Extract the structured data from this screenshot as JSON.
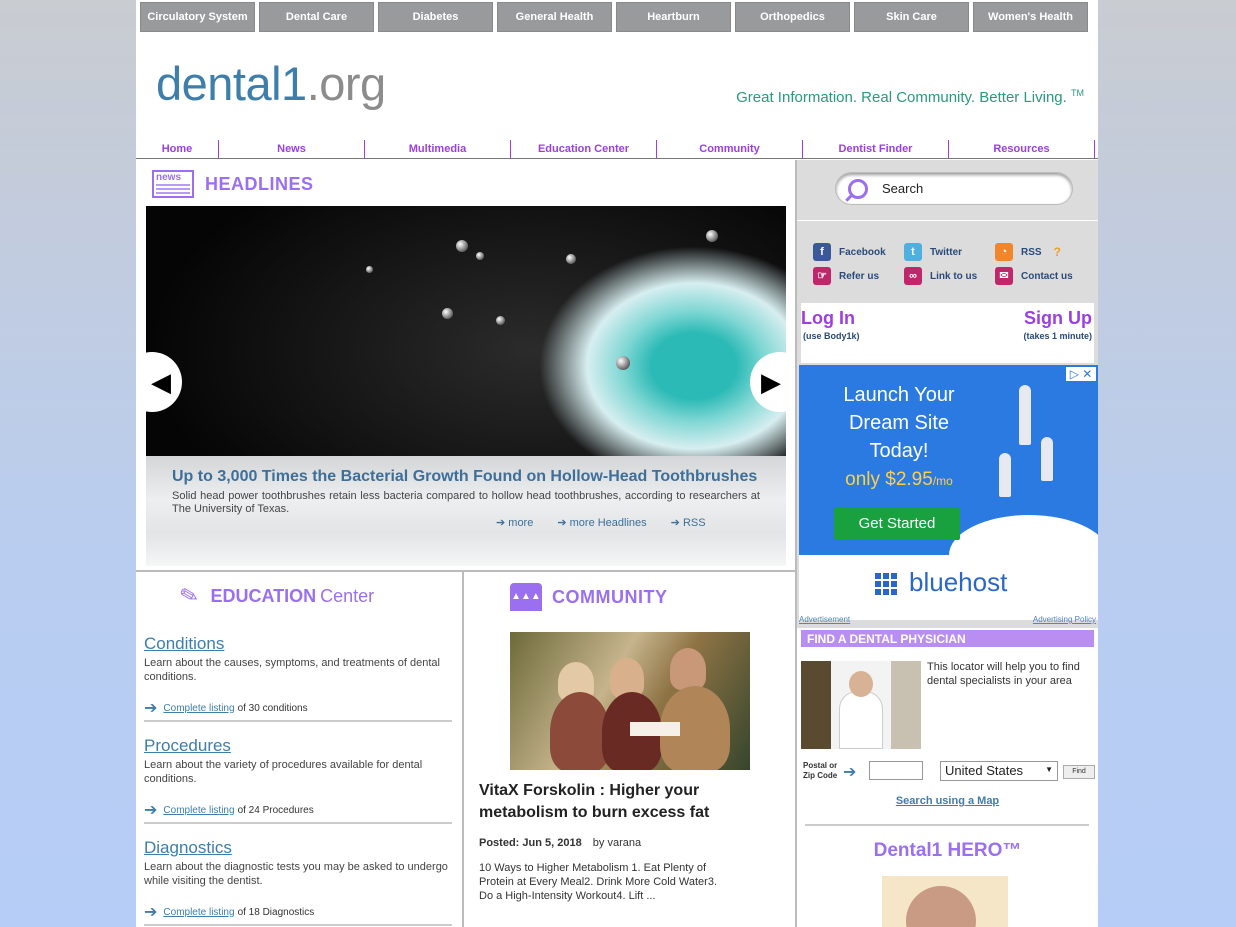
{
  "top_categories": [
    "Circulatory System",
    "Dental Care",
    "Diabetes",
    "General Health",
    "Heartburn",
    "Orthopedics",
    "Skin Care",
    "Women's Health"
  ],
  "logo": {
    "part1": "dental1",
    "part2": ".org"
  },
  "tagline": {
    "text": "Great Information.  Real Community.  Better Living.",
    "mark": "TM"
  },
  "main_nav": [
    "Home",
    "News",
    "Multimedia",
    "Education Center",
    "Community",
    "Dentist Finder",
    "Resources"
  ],
  "headlines": {
    "title": "HEADLINES",
    "icon_text": "news",
    "slide": {
      "title": "Up to 3,000 Times the Bacterial Growth Found on Hollow-Head Toothbrushes",
      "summary": "Solid head power toothbrushes retain less bacteria compared to hollow head toothbrushes, according to researchers at The University of Texas.",
      "links": [
        "more",
        "more Headlines",
        "RSS"
      ]
    }
  },
  "education": {
    "title_bold": "EDUCATION",
    "title_light": "Center",
    "blocks": [
      {
        "heading": "Conditions",
        "desc": "Learn about the causes, symptoms, and treatments of dental conditions.",
        "link": "Complete listing",
        "count": "of 30 conditions"
      },
      {
        "heading": "Procedures",
        "desc": "Learn about the variety of procedures available for dental conditions.",
        "link": "Complete listing",
        "count": "of 24 Procedures"
      },
      {
        "heading": "Diagnostics",
        "desc": "Learn about the diagnostic tests you may be asked to undergo while visiting the dentist.",
        "link": "Complete listing",
        "count": "of 18 Diagnostics"
      }
    ]
  },
  "community": {
    "title": "COMMUNITY",
    "post_title": "VitaX Forskolin : Higher your metabolism to burn excess fat",
    "posted": "Posted: Jun 5, 2018",
    "author": "by varana",
    "body": "10 Ways to Higher Metabolism 1. Eat Plenty of Protein at Every Meal2. Drink More Cold Water3. Do a High-Intensity Workout4. Lift ..."
  },
  "sidebar": {
    "search_placeholder": "Search",
    "social": [
      {
        "label": "Facebook",
        "icon": "facebook-icon",
        "color": "#3b5998"
      },
      {
        "label": "Twitter",
        "icon": "twitter-icon",
        "color": "#4fb0e0"
      },
      {
        "label": "RSS",
        "icon": "rss-icon",
        "color": "#f0852a"
      },
      {
        "label": "Refer us",
        "icon": "refer-icon",
        "color": "#c0266a"
      },
      {
        "label": "Link to us",
        "icon": "link-icon",
        "color": "#c0266a"
      },
      {
        "label": "Contact us",
        "icon": "mail-icon",
        "color": "#c0266a"
      }
    ],
    "rss_help": "?",
    "login": {
      "label": "Log In",
      "sub": "(use Body1k)"
    },
    "signup": {
      "label": "Sign Up",
      "sub": "(takes 1 minute)"
    },
    "ad": {
      "headline": "Launch Your Dream Site Today!",
      "price": "only $2.95",
      "price_unit": "/mo",
      "cta": "Get Started",
      "brand": "bluehost",
      "close": "▷ ✕"
    },
    "ad_notes": {
      "left": "Advertisement",
      "right": "Advertising Policy"
    },
    "physician": {
      "title": "FIND A DENTAL PHYSICIAN",
      "text": "This locator will help you to find dental specialists in your area",
      "zip_label": "Postal or Zip Code",
      "country": "United States",
      "find": "Find",
      "map_link": "Search using a Map"
    },
    "hero": {
      "title": "Dental1 HERO™"
    }
  },
  "colors": {
    "accent": "#9a6ff0",
    "link": "#3d7eab",
    "tagline": "#2a9a7a",
    "tab": "#999a9c"
  }
}
